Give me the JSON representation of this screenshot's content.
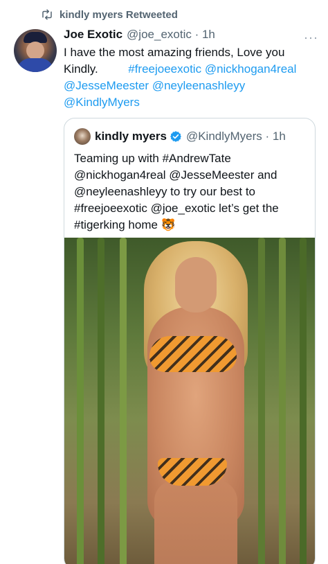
{
  "retweet": {
    "icon": "retweet-icon",
    "label": "kindly myers Retweeted"
  },
  "tweet": {
    "author_name": "Joe Exotic",
    "author_meta": "@joe_exotic · 1h",
    "more_icon": "more-dots-icon",
    "text_line1": "I have the most amazing friends, Love you",
    "text_kindly": "Kindly.",
    "links": [
      "#freejoeexotic",
      "@nickhogan4real",
      "@JesseMeester",
      "@neyleenashleyy",
      "@KindlyMyers"
    ]
  },
  "quote": {
    "author_name": "kindly myers",
    "author_meta": "@KindlyMyers · 1h",
    "verified_icon": "verified-badge-icon",
    "line1": "Teaming up with #AndrewTate",
    "line2": "@nickhogan4real @JesseMeester and",
    "line3": "@neyleenashleyy to try our best to",
    "line4": "#freejoeexotic @joe_exotic let’s get the",
    "line5": "#tigerking home 🐯",
    "image_alt": "photo"
  },
  "colors": {
    "link": "#1d9bf0",
    "meta": "#536471",
    "border": "#cfd9de"
  }
}
